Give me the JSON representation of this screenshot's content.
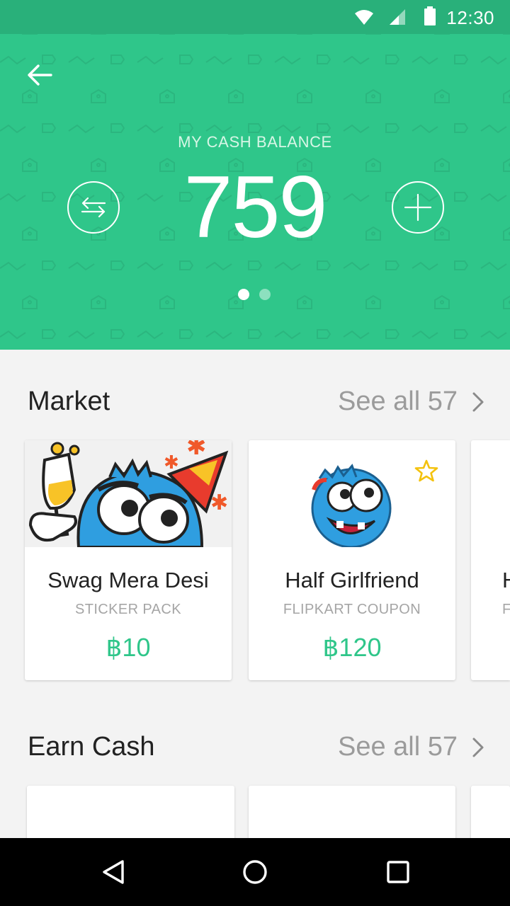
{
  "status_bar": {
    "time": "12:30",
    "icons": [
      "wifi-icon",
      "signal-icon",
      "battery-icon"
    ]
  },
  "header": {
    "back_icon": "arrow-left-icon",
    "balance_label": "MY CASH BALANCE",
    "balance_value": "759",
    "transfer_icon": "transfer-icon",
    "add_icon": "plus-icon",
    "pager": {
      "count": 2,
      "active_index": 0
    },
    "background_color": "#2fc68a"
  },
  "market": {
    "title": "Market",
    "see_all": "See all 57",
    "cards": [
      {
        "title": "Swag Mera Desi",
        "subtitle": "STICKER PACK",
        "price": "฿10"
      },
      {
        "title": "Half Girlfriend",
        "subtitle": "FLIPKART COUPON",
        "price": "฿120",
        "starred": true
      },
      {
        "title": "H",
        "subtitle": "F"
      }
    ]
  },
  "earn_cash": {
    "title": "Earn Cash",
    "see_all": "See all 57"
  },
  "accent_color": "#2fc68a",
  "nav_bar": {
    "buttons": [
      "back-triangle-icon",
      "home-circle-icon",
      "recents-square-icon"
    ]
  }
}
